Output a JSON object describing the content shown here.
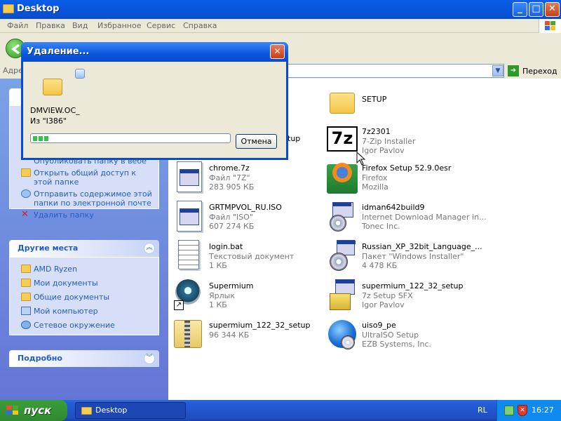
{
  "window": {
    "title": "Desktop",
    "minimize_label": "_",
    "maximize_label": "□",
    "close_label": "✕"
  },
  "menu": [
    "Файл",
    "Правка",
    "Вид",
    "Избранное",
    "Сервис",
    "Справка"
  ],
  "address": {
    "label": "Адре",
    "go_label": "Переход"
  },
  "sidebar": {
    "tasks_partial": {
      "items": [
        "Опубликовать папку в вебе",
        "Открыть общий доступ к этой папке",
        "Отправить содержимое этой папки по электронной почте",
        "Удалить папку"
      ]
    },
    "other_places": {
      "title": "Другие места",
      "items": [
        "AMD Ryzen",
        "Мои документы",
        "Общие документы",
        "Мой компьютер",
        "Сетевое окружение"
      ]
    },
    "details": {
      "title": "Подробно"
    }
  },
  "files": [
    {
      "name": "SETUP",
      "line1": "",
      "line2": ""
    },
    {
      "name": "7z2301",
      "line1": "7-Zip Installer",
      "line2": "Igor Pavlov"
    },
    {
      "name": "chrome.7z",
      "line1": "Файл \"7Z\"",
      "line2": "283 905 КБ"
    },
    {
      "name": "Firefox Setup 52.9.0esr",
      "line1": "Firefox",
      "line2": "Mozilla"
    },
    {
      "name": "GRTMPVOL_RU.ISO",
      "line1": "Файл \"ISO\"",
      "line2": "607 274 КБ"
    },
    {
      "name": "idman642build9",
      "line1": "Internet Download Manager in...",
      "line2": "Tonec Inc."
    },
    {
      "name": "login.bat",
      "line1": "Текстовый документ",
      "line2": "1 КБ"
    },
    {
      "name": "Russian_XP_32bit_Language_...",
      "line1": "Пакет \"Windows Installer\"",
      "line2": "4 478 КБ"
    },
    {
      "name": "Supermium",
      "line1": "Ярлык",
      "line2": "1 КБ"
    },
    {
      "name": "supermium_122_32_setup",
      "line1": "7z Setup SFX",
      "line2": "Igor Pavlov"
    },
    {
      "name": "supermium_122_32_setup",
      "line1": "96 344 КБ",
      "line2": ""
    },
    {
      "name": "uiso9_pe",
      "line1": "UltraISO Setup",
      "line2": "EZB Systems, Inc."
    }
  ],
  "partial_text": {
    "tup": "tup",
    "ta": "ta"
  },
  "dialog": {
    "title": "Удаление...",
    "close_label": "✕",
    "file": "DMVIEW.OC_",
    "from": "Из \"I386\"",
    "cancel": "Отмена",
    "progress": 0.08
  },
  "taskbar": {
    "start": "пуск",
    "task": "Desktop",
    "lang": "RL",
    "clock": "16:27"
  },
  "colors": {
    "xp_blue": "#0a5ee8",
    "sidebar": "#6f8ee0",
    "link": "#215dc6"
  }
}
